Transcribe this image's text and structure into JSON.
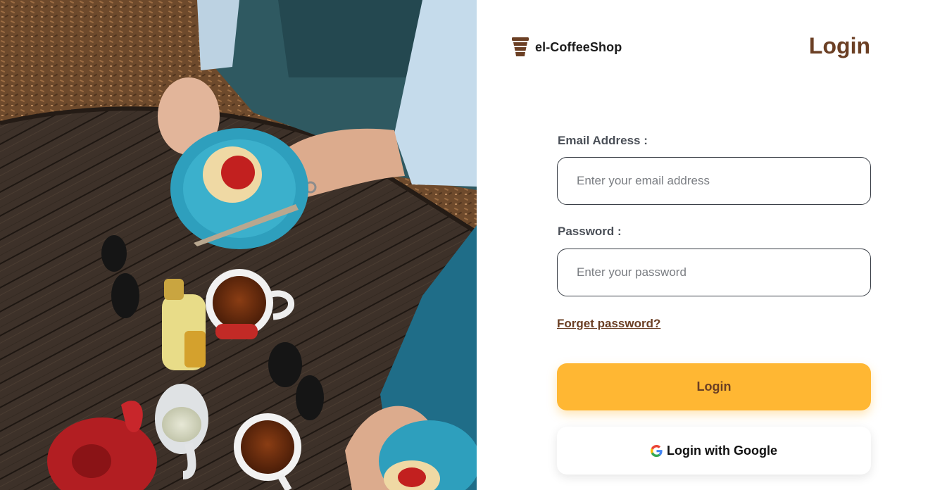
{
  "brand": {
    "name": "el-CoffeeShop",
    "icon": "coffee-cup-icon"
  },
  "page": {
    "title": "Login"
  },
  "form": {
    "email": {
      "label": "Email Address :",
      "placeholder": "Enter your email address",
      "value": ""
    },
    "password": {
      "label": "Password :",
      "placeholder": "Enter your password",
      "value": ""
    },
    "forgot_link": "Forget password?",
    "login_button": "Login",
    "google_button": "Login with Google",
    "google_icon": "google-g-icon"
  },
  "colors": {
    "accent": "#ffb733",
    "brown": "#6b3f24",
    "label": "#4a4f57"
  }
}
